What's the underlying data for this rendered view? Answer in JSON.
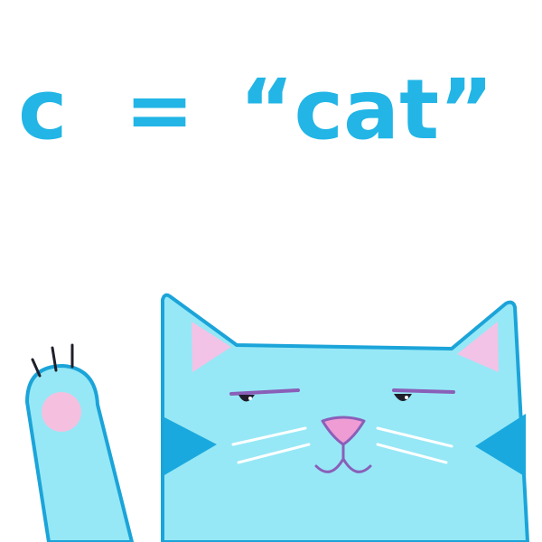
{
  "headline": {
    "variable": "c",
    "operator": "=",
    "value": "“cat”"
  },
  "colors": {
    "text": "#22b5e6",
    "cat_fill": "#96e8f6",
    "cat_outline": "#1ba4d9",
    "cheek": "#1aa9de",
    "ear_inner": "#f2c3e6",
    "paw_pad": "#f5c0df",
    "nose": "#ef9cd4",
    "mouth": "#8a5fb8",
    "brow": "#8a5fb8",
    "claws": "#1f1f2b",
    "whiskers": "#ffffff"
  },
  "illustration": {
    "subject": "cat-face",
    "paw": "raised-paw"
  }
}
